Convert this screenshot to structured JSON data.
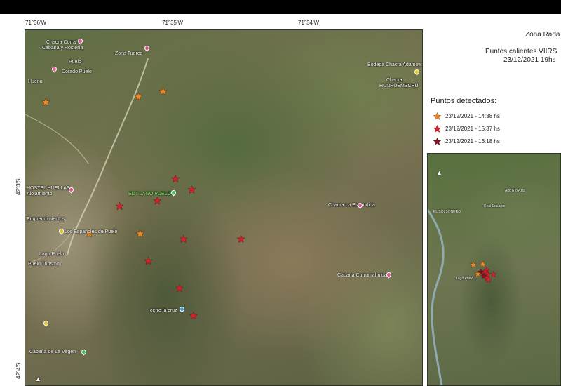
{
  "coords": {
    "top": [
      "71°36'W",
      "71°35'W",
      "71°34'W"
    ],
    "left": [
      "42°3'S",
      "42°4'S"
    ]
  },
  "title": {
    "line1": "Zona Rada",
    "line2": "Puntos calientes VIIRS",
    "line3": "23/12/2021 19hs"
  },
  "legend": {
    "title": "Puntos detectados:",
    "items": [
      {
        "label": "23/12/2021 -  14:38 hs",
        "color": "#f08a24"
      },
      {
        "label": "23/12/2021 -  15:37 hs",
        "color": "#d8202a"
      },
      {
        "label": "23/12/2021 -  16:18 hs",
        "color": "#8a1020"
      }
    ]
  },
  "places": [
    "Chacra Corral",
    "Cabaña y Hostería",
    "Zona Tuerca",
    "Puelo",
    "Dorado Puelo",
    "Bodega Chacra Adamow",
    "Chacra",
    "HUNHUEMECHU",
    "Huenu",
    "EDT LAGO PUELO",
    "HOSTEL HUELLAS",
    "Alojamiento",
    "Emprendimientos",
    "Los Españoles de Puelo",
    "Lago Puelo",
    "Puelo Turismo",
    "Chacra La Escondida",
    "Cabaña Currumahuida",
    "cerro la cruz",
    "Cabaña de La Virgen"
  ],
  "inset_places": [
    "EL BOLSONERO",
    "Alto Río Azul",
    "Real Eduardo",
    "Lago Puelo"
  ],
  "points": [
    {
      "lon": -71.6018,
      "lat": -42.054,
      "series": 0
    },
    {
      "lon": -71.5905,
      "lat": -42.0535,
      "series": 0
    },
    {
      "lon": -71.5875,
      "lat": -42.053,
      "series": 0
    },
    {
      "lon": -71.586,
      "lat": -42.061,
      "series": 1
    },
    {
      "lon": -71.584,
      "lat": -42.062,
      "series": 1
    },
    {
      "lon": -71.5882,
      "lat": -42.063,
      "series": 1
    },
    {
      "lon": -71.5928,
      "lat": -42.0635,
      "series": 1
    },
    {
      "lon": -71.5965,
      "lat": -42.066,
      "series": 0
    },
    {
      "lon": -71.5903,
      "lat": -42.066,
      "series": 0
    },
    {
      "lon": -71.585,
      "lat": -42.0665,
      "series": 1
    },
    {
      "lon": -71.578,
      "lat": -42.0665,
      "series": 1
    },
    {
      "lon": -71.5893,
      "lat": -42.0685,
      "series": 1
    },
    {
      "lon": -71.5855,
      "lat": -42.071,
      "series": 1
    },
    {
      "lon": -71.5838,
      "lat": -42.0735,
      "series": 1
    }
  ],
  "inset_points": [
    {
      "lon": -71.6018,
      "lat": -42.054,
      "series": 0
    },
    {
      "lon": -71.5905,
      "lat": -42.0535,
      "series": 0
    },
    {
      "lon": -71.586,
      "lat": -42.061,
      "series": 1
    },
    {
      "lon": -71.5882,
      "lat": -42.063,
      "series": 1
    },
    {
      "lon": -71.5928,
      "lat": -42.0635,
      "series": 2
    },
    {
      "lon": -71.5965,
      "lat": -42.066,
      "series": 0
    },
    {
      "lon": -71.585,
      "lat": -42.0665,
      "series": 1
    },
    {
      "lon": -71.578,
      "lat": -42.0665,
      "series": 1
    },
    {
      "lon": -71.5893,
      "lat": -42.0685,
      "series": 2
    },
    {
      "lon": -71.5855,
      "lat": -42.071,
      "series": 1
    },
    {
      "lon": -71.5838,
      "lat": -42.0735,
      "series": 1
    }
  ]
}
